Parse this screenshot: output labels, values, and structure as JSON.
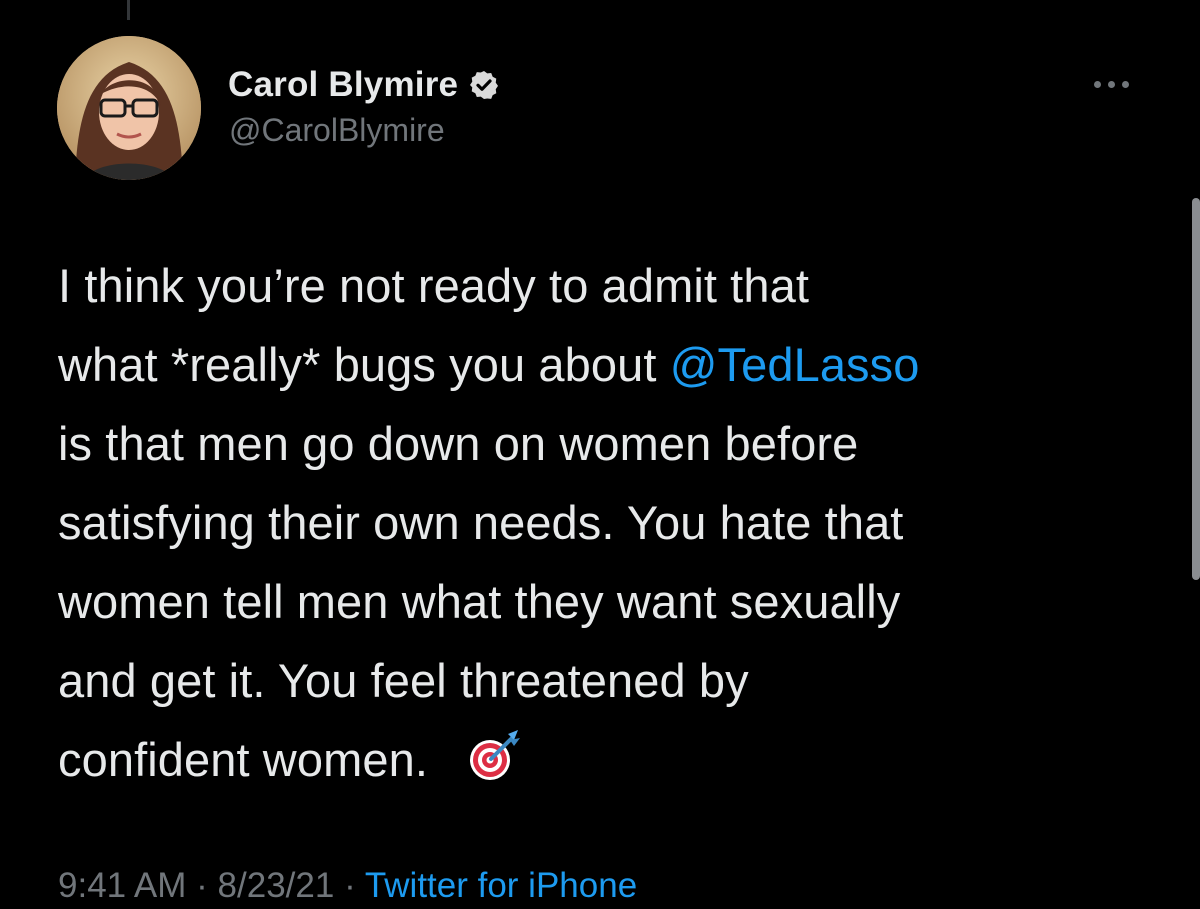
{
  "tweet": {
    "author": {
      "display_name": "Carol Blymire",
      "handle": "@CarolBlymire",
      "verified": true
    },
    "text_lines": [
      "I think you’re not ready to admit that",
      "what *really* bugs you about ",
      "is that men go down on women before",
      "satisfying their own needs. You hate that",
      "women tell men what they want sexually",
      "and get it. You feel threatened by",
      "confident women."
    ],
    "mention": "@TedLasso",
    "emoji": "direct-hit-dart-icon",
    "time": "9:41 AM",
    "separator": "·",
    "date": "8/23/21",
    "source": "Twitter for iPhone"
  },
  "colors": {
    "background": "#000000",
    "text": "#e7e9ea",
    "secondary_text": "#71767b",
    "link": "#1d9bf0"
  }
}
